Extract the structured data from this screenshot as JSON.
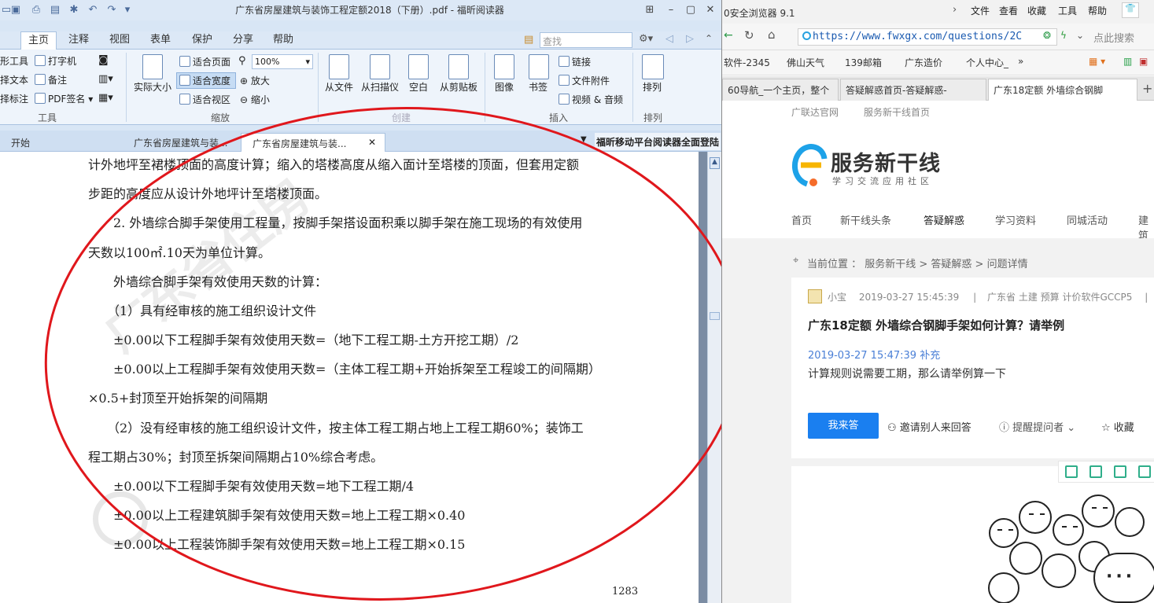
{
  "reader": {
    "title": "广东省房屋建筑与装饰工程定额2018（下册）.pdf - 福昕阅读器",
    "menu": [
      "主页",
      "注释",
      "视图",
      "表单",
      "保护",
      "分享",
      "帮助"
    ],
    "search_placeholder": "查找",
    "ribbon": {
      "tools": {
        "items": [
          "形工具",
          "择文本",
          "择标注",
          "打字机",
          "备注",
          "PDF签名"
        ],
        "label": "工具"
      },
      "zoom": {
        "actual_size": "实际大小",
        "fit_page": "适合页面",
        "fit_width": "适合宽度",
        "fit_view": "适合视区",
        "zoom_in": "放大",
        "zoom_out": "缩小",
        "zoom_value": "100%",
        "label": "缩放"
      },
      "create": {
        "items": [
          "从文件",
          "从扫描仪",
          "空白",
          "从剪贴板"
        ],
        "label": "创建"
      },
      "insert": {
        "items": [
          "图像",
          "书签"
        ],
        "link": "链接",
        "attachment": "文件附件",
        "video": "视频 & 音频",
        "label": "插入"
      },
      "arrange": {
        "item": "排列",
        "label": "排列"
      }
    },
    "doc_tabs": [
      "开始",
      "广东省房屋建筑与装...",
      "广东省房屋建筑与装..."
    ],
    "promo": "福昕移动平台阅读器全面登陆",
    "document_lines": [
      "计外地坪至裙楼顶面的高度计算；缩入的塔楼高度从缩入面计至塔楼的顶面，但套用定额",
      "步距的高度应从设计外地坪计至塔楼顶面。",
      "　　2. 外墙综合脚手架使用工程量，按脚手架搭设面积乘以脚手架在施工现场的有效使用",
      "天数以100㎡.10天为单位计算。",
      "　　外墙综合脚手架有效使用天数的计算：",
      "　　（1）具有经审核的施工组织设计文件",
      "　　±0.00以下工程脚手架有效使用天数=（地下工程工期-土方开挖工期）/2",
      "　　±0.00以上工程脚手架有效使用天数=（主体工程工期+开始拆架至工程竣工的间隔期）",
      "×0.5+封顶至开始拆架的间隔期",
      "　　（2）没有经审核的施工组织设计文件，按主体工程工期占地上工程工期60%；装饰工",
      "程工期占30%；封顶至拆架间隔期占10%综合考虑。",
      "　　±0.00以下工程脚手架有效使用天数=地下工程工期/4",
      "　　±0.00以上工程建筑脚手架有效使用天数=地上工程工期×0.40",
      "　　±0.00以上工程装饰脚手架有效使用天数=地上工程工期×0.15"
    ],
    "page_number": "1283",
    "watermark": "广东省住房"
  },
  "browser": {
    "title": "0安全浏览器 9.1",
    "menu": [
      "文件",
      "查看",
      "收藏",
      "工具",
      "帮助"
    ],
    "url": "https://www.fwxgx.com/questions/2C",
    "search_hint": "点此搜索",
    "bookmarks": [
      "软件-2345",
      "佛山天气",
      "139邮箱",
      "广东造价",
      "个人中心_"
    ],
    "tabs": [
      "60导航_一个主页，整个",
      "答疑解惑首页-答疑解惑-",
      "广东18定额 外墙综合钢脚"
    ],
    "site": {
      "top_links": [
        "广联达官网",
        "服务新干线首页"
      ],
      "logo": "服务新干线",
      "logo_sub": "学习交流应用社区",
      "nav": [
        "首页",
        "新干线头条",
        "答疑解惑",
        "学习资料",
        "同城活动",
        "建筑"
      ],
      "breadcrumb": "当前位置 ： 服务新干线 > 答疑解惑 > 问题详情",
      "question": {
        "user": "小宝",
        "time": "2019-03-27 15:45:39",
        "tags": "广东省  土建 预算 计价软件GCCP5",
        "title": "广东18定额 外墙综合钢脚手架如何计算？请举例",
        "supplement": "2019-03-27 15:47:39 补充",
        "body": "计算规则说需要工期，那么请举例算一下",
        "answer_button": "我来答",
        "invite": "邀请别人来回答",
        "remind": "提醒提问者",
        "favorite": "收藏"
      }
    }
  }
}
